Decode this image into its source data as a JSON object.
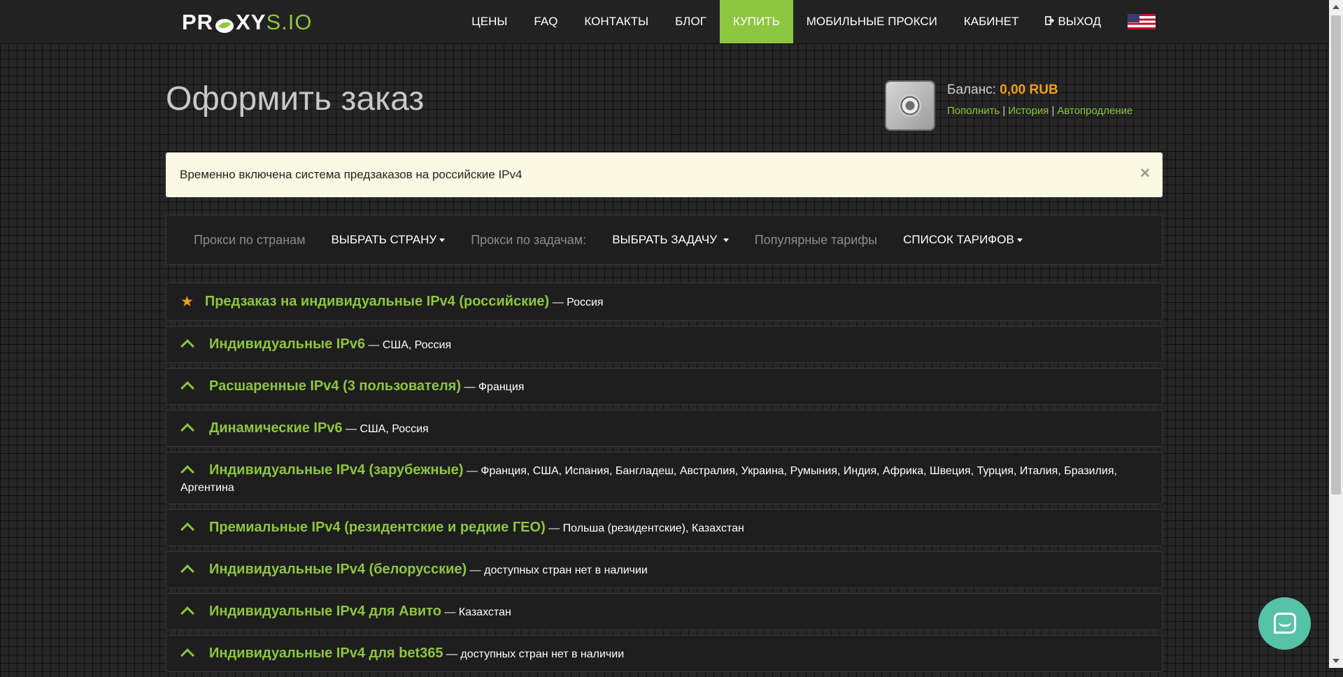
{
  "logo": {
    "part1": "PR",
    "part1b": "XY",
    "part2": "S.IO"
  },
  "nav": {
    "prices": "ЦЕНЫ",
    "faq": "FAQ",
    "contacts": "КОНТАКТЫ",
    "blog": "БЛОГ",
    "buy": "КУПИТЬ",
    "mobile": "МОБИЛЬНЫЕ ПРОКСИ",
    "cabinet": "КАБИНЕТ",
    "logout": "ВЫХОД"
  },
  "header": {
    "title": "Оформить заказ",
    "balance_label": "Баланс:",
    "balance_amount": "0,00 RUB",
    "link_topup": "Пополнить",
    "link_history": "История",
    "link_autorenew": "Автопродление"
  },
  "alert": {
    "text": "Временно включена система предзаказов на российские IPv4",
    "close": "×"
  },
  "filters": {
    "by_country_label": "Прокси по странам",
    "by_country_drop": "ВЫБРАТЬ СТРАНУ",
    "by_task_label": "Прокси по задачам:",
    "by_task_drop": "ВЫБРАТЬ ЗАДАЧУ",
    "popular_label": "Популярные тарифы",
    "popular_drop": "СПИСОК ТАРИФОВ"
  },
  "products": [
    {
      "title": "Предзаказ на индивидуальные IPv4 (российские)",
      "countries": "— Россия",
      "icon": "star-icon"
    },
    {
      "title": "Индивидуальные IPv6",
      "countries": "— США, Россия",
      "icon": "chevron-up-icon"
    },
    {
      "title": "Расшаренные IPv4 (3 пользователя)",
      "countries": "— Франция",
      "icon": "chevron-up-icon"
    },
    {
      "title": "Динамические IPv6",
      "countries": "— США, Россия",
      "icon": "chevron-up-icon"
    },
    {
      "title": "Индивидуальные IPv4 (зарубежные)",
      "countries": "— Франция, США, Испания, Бангладеш, Австралия, Украина, Румыния, Индия, Африка, Швеция, Турция, Италия, Бразилия, Аргентина",
      "icon": "chevron-up-icon"
    },
    {
      "title": "Премиальные IPv4 (резидентские и редкие ГЕО)",
      "countries": "— Польша (резидентские), Казахстан",
      "icon": "chevron-up-icon"
    },
    {
      "title": "Индивидуальные IPv4 (белорусские)",
      "countries": "— доступных стран нет в наличии",
      "icon": "chevron-up-icon"
    },
    {
      "title": "Индивидуальные IPv4 для Авито",
      "countries": "— Казахстан",
      "icon": "chevron-up-icon"
    },
    {
      "title": "Индивидуальные IPv4 для bet365",
      "countries": "— доступных стран нет в наличии",
      "icon": "chevron-up-icon"
    }
  ],
  "colors": {
    "accent": "#8dc63f",
    "balance": "#f0a017",
    "alert_bg": "#fcf8e3",
    "chat": "#56c2a7"
  }
}
